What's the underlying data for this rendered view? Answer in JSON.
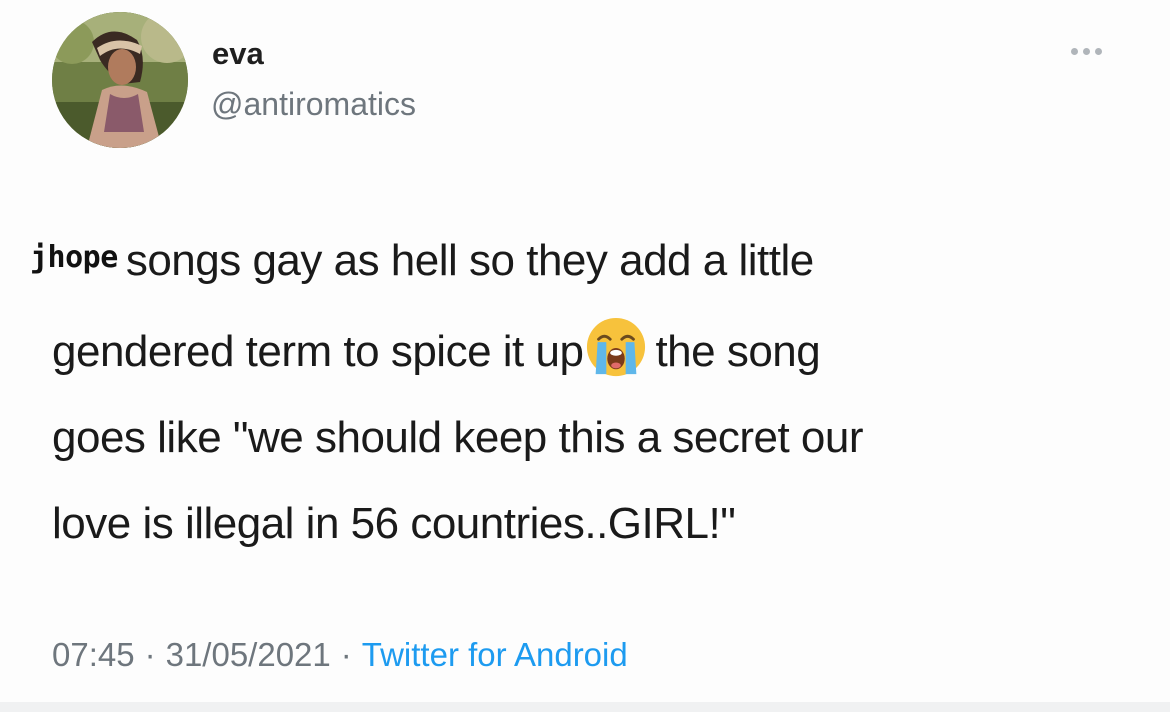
{
  "author": {
    "display_name": "eva",
    "handle": "@antiromatics",
    "avatar_icon": "profile-photo"
  },
  "menu": {
    "icon": "more-horizontal-icon"
  },
  "tweet": {
    "overlay_text": "jhope",
    "line1_rest": "songs gay as hell so they add a little",
    "line2_before_emoji": "gendered term to spice it up",
    "emoji_icon": "loudly-crying-face-emoji",
    "line2_after_emoji": "the song",
    "line3": "goes like \"we should keep this a secret our",
    "line4": "love is illegal in 56 countries..GIRL!\""
  },
  "meta": {
    "time": "07:45",
    "separator": "·",
    "date": "31/05/2021",
    "source": "Twitter for Android",
    "source_color": "#1d9bf0"
  }
}
